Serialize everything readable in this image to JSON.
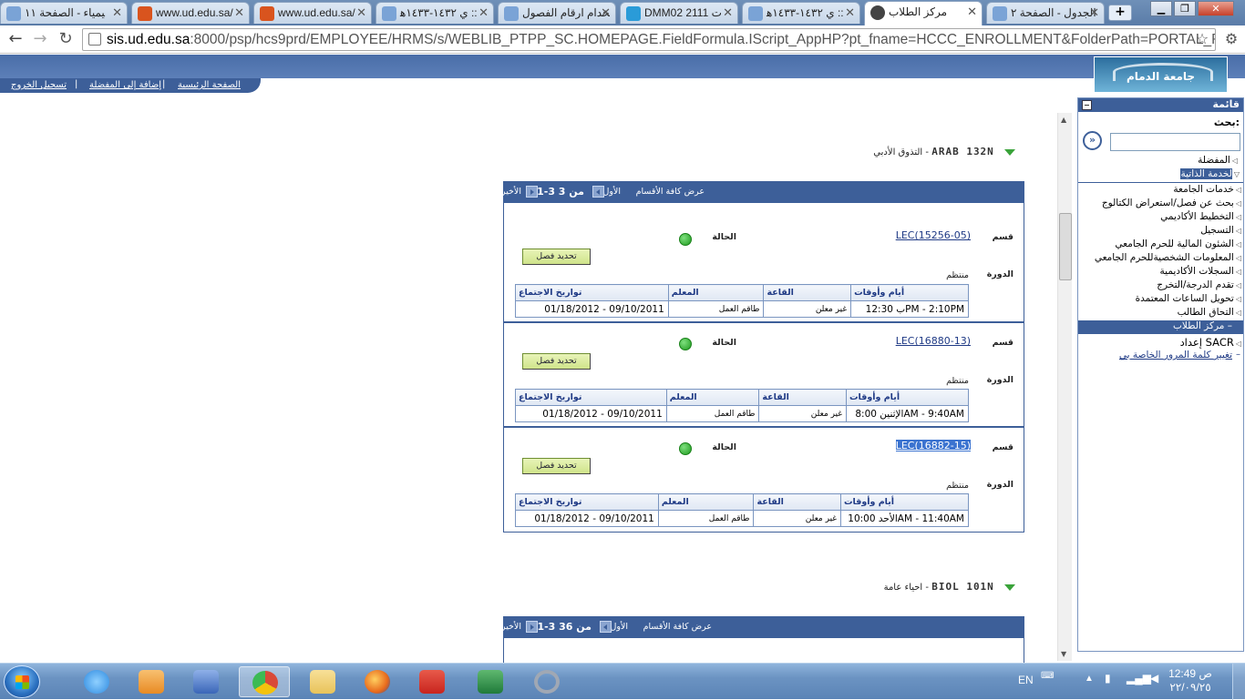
{
  "browser": {
    "tabs": [
      {
        "label": "ﻴﻤﻴﺎﺀ - ﺍﻟﺼﻔﺤﺔ ١١",
        "favicon": "doc-icon",
        "color": "#7aa3d6"
      },
      {
        "label": "www.ud.edu.sa/",
        "favicon": "xampp-icon",
        "color": "#d9541e"
      },
      {
        "label": "www.ud.edu.sa/",
        "favicon": "xampp-icon",
        "color": "#d9541e"
      },
      {
        "label": "ﻱ ١٤٣٢-١٤٣٣ﻫ ::",
        "favicon": "doc-icon",
        "color": "#7aa3d6"
      },
      {
        "label": "ﺨﺪﺍﻡ ﺍﺭﻗﺎﻡ ﺍﻟﻔﺼﻮﻝ",
        "favicon": "doc-icon",
        "color": "#7aa3d6"
      },
      {
        "label": "DMM02 2111 ﺕ",
        "favicon": "star-icon",
        "color": "#2a9bd8"
      },
      {
        "label": "ﻱ ١٤٣٢-١٤٣٣ﻫ ::",
        "favicon": "doc-icon",
        "color": "#7aa3d6"
      },
      {
        "label": "ﻣﺮﻛﺰ ﺍﻟﻄﻼﺏ",
        "favicon": "globe-icon",
        "color": "#444444",
        "active": true
      },
      {
        "label": "ﺍﻟﺠﺪﻭﻝ - ﺍﻟﺼﻔﺤﺔ ٢",
        "favicon": "doc-icon",
        "color": "#7aa3d6"
      }
    ],
    "new_tab": "+",
    "url_host": "sis.ud.edu.sa",
    "url_rest": ":8000/psp/hcs9prd/EMPLOYEE/HRMS/s/WEBLIB_PTPP_SC.HOMEPAGE.FieldFormula.IScript_AppHP?pt_fname=HCCC_ENROLLMENT&FolderPath=PORTAL_ROOT_OBJECT"
  },
  "header": {
    "nav": {
      "home": "ﺍﻟﺼﻔﺤﺔ ﺍﻟﺮﺋﻴﺴﻴﺔ",
      "favorites": "ﺇﺿﺎﻓﺔ ﺇﻟﻰ ﺍﻟﻤﻔﻀﻠﺔ",
      "logout": "ﺗﺴﺠﻴﻞ ﺍﻟﺨﺮﻭﺝ"
    },
    "logo_text": "ﺟﺎﻣﻌﺔ ﺍﻟﺪﻣﺎﻡ"
  },
  "menu": {
    "title": "ﻗﺎﺋﻤﺔ",
    "search_label": "ﺑﺤﺚ:",
    "favorites": "ﺍﻟﻤﻔﻀﻠﺔ",
    "self_service": "ﻟﺨﺪﻣﺔ ﺍﻟﺬﺍﺗﻴﺔ",
    "items": [
      "ﺧﺪﻣﺎﺕ ﺍﻟﺠﺎﻣﻌﺔ",
      "ﺑﺤﺚ ﻋﻦ ﻓﺼﻞ/ﺍﺳﺘﻌﺮﺍﺽ ﺍﻟﻜﺘﺎﻟﻮﺝ",
      "ﺍﻟﺘﺨﻄﻴﻂ ﺍﻷﻛﺎﺩﻳﻤﻲ",
      "ﺍﻟﺘﺴﺠﻴﻞ",
      "ﺍﻟﺸﺌﻮﻥ ﺍﻟﻤﺎﻟﻴﺔ ﻟﻠﺤﺮﻡ ﺍﻟﺠﺎﻣﻌﻲ",
      "ﺍﻟﻤﻌﻠﻮﻣﺎﺕ ﺍﻟﺸﺨﺼﻴﺔﻟﻠﺤﺮﻡ ﺍﻟﺠﺎﻣﻌﻲ",
      "ﺍﻟﺴﺠﻼﺕ ﺍﻷﻛﺎﺩﻳﻤﻴﺔ",
      "ﺗﻘﺪﻡ ﺍﻟﺪﺭﺟﺔ/ﺍﻟﺘﺨﺮﺝ",
      "ﺗﺤﻮﻳﻞ ﺍﻟﺴﺎﻋﺎﺕ ﺍﻟﻤﻌﺘﻤﺪﺓ",
      "ﺍﻟﺘﺤﺎﻕ ﺍﻟﻄﺎﻟﺐ"
    ],
    "student_center": "ﻣﺮﻛﺰ ﺍﻟﻄﻼﺏ",
    "sacr": "ﺇﻋﺪﺍﺩ SACR",
    "change_password": "ﺗﻐﻴﻴﺮ ﻛﻠﻤﺔ ﺍﻟﻤﺮﻭﺭ ﺍﻟﺨﺎﺻﺔ ﺑﻲ"
  },
  "course1": {
    "code": "ARAB  132N",
    "title": "ﺍﻟﺘﺬﻭﻕ ﺍﻷﺩﺑﻲ",
    "dash": "-",
    "grid": {
      "view_all": "ﻋﺮﺽ ﻛﺎﻓﺔ ﺍﻷﻗﺴﺎﻡ",
      "first": "ﺍﻷﻭﻝ",
      "range": "1-3 ﻣﻦ 3",
      "last": "ﺍﻷﺧﻴﺮ"
    },
    "sections": [
      {
        "section_label": "ﻗﺴﻢ",
        "section": "LEC(15256-05)",
        "status_label": "ﺍﻟﺤﺎﻟﺔ",
        "select": "ﺗﺤﺪﻳﺪ ﻓﺼﻞ",
        "session_label": "ﺍﻟﺪﻭﺭﺓ",
        "session": "ﻣﻨﺘﻈﻢ",
        "headers": [
          "ﺃﻳﺎﻡ ﻭﺃﻭﻗﺎﺕ",
          "ﺍﻟﻘﺎﻋﺔ",
          "ﺍﻟﻤﻌﻠﻢ",
          "ﺗﻮﺍﺭﻳﺦ ﺍﻻﺟﺘﻤﺎﻉ"
        ],
        "row": [
          "ﺏ 12:30PM - 2:10PM",
          "ﻏﻴﺮ ﻣﻌﻠﻦ",
          "ﻃﺎﻗﻢ ﺍﻟﻌﻤﻞ",
          "01/18/2012 - 09/10/2011"
        ]
      },
      {
        "section_label": "ﻗﺴﻢ",
        "section": "LEC(16880-13)",
        "status_label": "ﺍﻟﺤﺎﻟﺔ",
        "select": "ﺗﺤﺪﻳﺪ ﻓﺼﻞ",
        "session_label": "ﺍﻟﺪﻭﺭﺓ",
        "session": "ﻣﻨﺘﻈﻢ",
        "headers": [
          "ﺃﻳﺎﻡ ﻭﺃﻭﻗﺎﺕ",
          "ﺍﻟﻘﺎﻋﺔ",
          "ﺍﻟﻤﻌﻠﻢ",
          "ﺗﻮﺍﺭﻳﺦ ﺍﻻﺟﺘﻤﺎﻉ"
        ],
        "row": [
          "ﺍﻹﺛﻨﻴﻦ 8:00AM - 9:40AM",
          "ﻏﻴﺮ ﻣﻌﻠﻦ",
          "ﻃﺎﻗﻢ ﺍﻟﻌﻤﻞ",
          "01/18/2012 - 09/10/2011"
        ]
      },
      {
        "section_label": "ﻗﺴﻢ",
        "section": "LEC(16882-15)",
        "status_label": "ﺍﻟﺤﺎﻟﺔ",
        "select": "ﺗﺤﺪﻳﺪ ﻓﺼﻞ",
        "session_label": "ﺍﻟﺪﻭﺭﺓ",
        "session": "ﻣﻨﺘﻈﻢ",
        "headers": [
          "ﺃﻳﺎﻡ ﻭﺃﻭﻗﺎﺕ",
          "ﺍﻟﻘﺎﻋﺔ",
          "ﺍﻟﻤﻌﻠﻢ",
          "ﺗﻮﺍﺭﻳﺦ ﺍﻻﺟﺘﻤﺎﻉ"
        ],
        "row": [
          "ﺍﻷﺣﺪ 10:00AM - 11:40AM",
          "ﻏﻴﺮ ﻣﻌﻠﻦ",
          "ﻃﺎﻗﻢ ﺍﻟﻌﻤﻞ",
          "01/18/2012 - 09/10/2011"
        ]
      }
    ]
  },
  "course2": {
    "code": "BIOL  101N",
    "title": "ﺍﺣﻴﺎﺀ ﻋﺎﻣﺔ",
    "dash": "-",
    "grid": {
      "view_all": "ﻋﺮﺽ ﻛﺎﻓﺔ ﺍﻷﻗﺴﺎﻡ",
      "first": "ﺍﻷﻭﻝ",
      "range": "1-3 ﻣﻦ 36",
      "last": "ﺍﻷﺧﻴﺮ"
    }
  },
  "taskbar": {
    "apps": [
      {
        "name": "ie-icon",
        "color": "#2e8ae0"
      },
      {
        "name": "media-player-icon",
        "color": "#e88b24"
      },
      {
        "name": "tools-icon",
        "color": "#3a66b8"
      },
      {
        "name": "chrome-icon",
        "color": "#d94a38",
        "active": true
      },
      {
        "name": "folder-icon",
        "color": "#e8c35a"
      },
      {
        "name": "firefox-icon",
        "color": "#e86a1c"
      },
      {
        "name": "acrobat-icon",
        "color": "#c8241e"
      },
      {
        "name": "excel-icon",
        "color": "#1f7a3a"
      },
      {
        "name": "loading-icon",
        "color": "#a0a8b4"
      }
    ],
    "lang": "EN",
    "time": "ﺹ 12:49",
    "date": "٢٢/٠٩/٢٥"
  }
}
